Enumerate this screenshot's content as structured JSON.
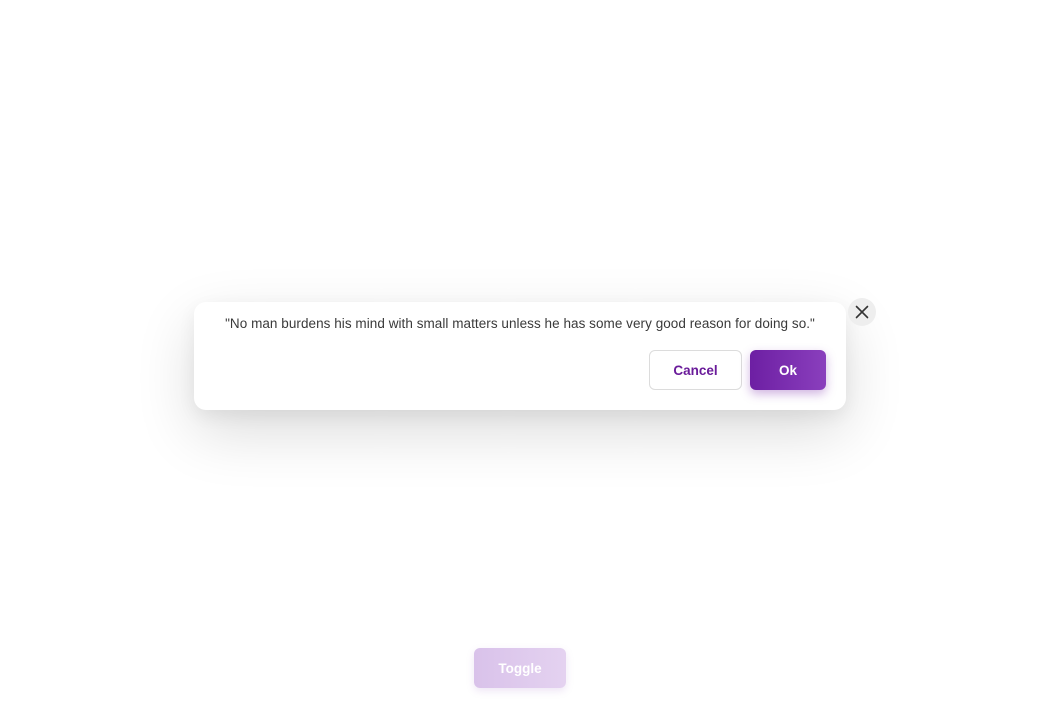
{
  "dialog": {
    "message": "\"No man burdens his mind with small matters unless he has some very good reason for doing so.\"",
    "close_icon": "close-icon",
    "cancel_label": "Cancel",
    "ok_label": "Ok"
  },
  "toggle": {
    "label": "Toggle"
  },
  "colors": {
    "accent": "#6d1fa3",
    "accent_light": "#8a3fbd",
    "toggle_faded": "#dcc6ec",
    "text": "#3a3a3a"
  }
}
